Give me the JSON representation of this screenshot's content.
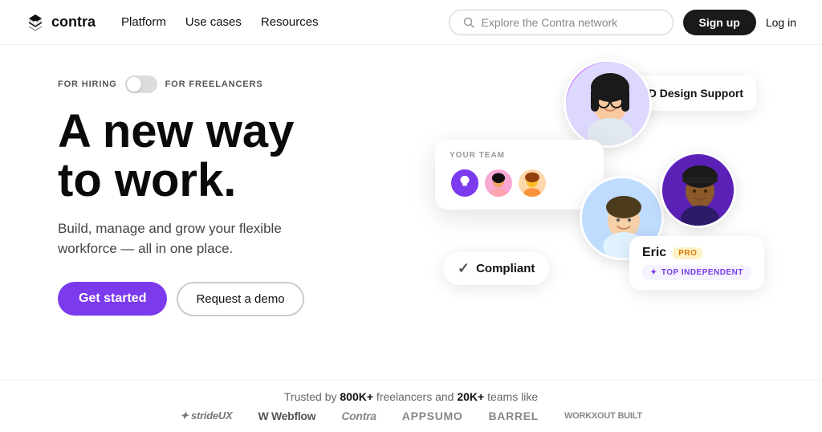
{
  "nav": {
    "logo_text": "contra",
    "links": [
      {
        "label": "Platform"
      },
      {
        "label": "Use cases"
      },
      {
        "label": "Resources"
      }
    ],
    "search_placeholder": "Explore the Contra network",
    "signup_label": "Sign up",
    "login_label": "Log in"
  },
  "toggle": {
    "for_hiring": "FOR HIRING",
    "for_freelancers": "FOR FREELANCERS"
  },
  "hero": {
    "title_line1": "A new way",
    "title_line2": "to work.",
    "subtitle": "Build, manage and grow your flexible workforce — all in one place.",
    "cta_primary": "Get started",
    "cta_secondary": "Request a demo"
  },
  "visual": {
    "team_card_label": "YOUR TEAM",
    "design_badge_label": "3D Design Support",
    "compliant_label": "Compliant",
    "eric_name": "Eric",
    "pro_badge": "PRO",
    "top_badge": "TOP INDEPENDENT"
  },
  "trusted": {
    "text_pre": "Trusted by ",
    "freelancers": "800K+",
    "text_mid": " freelancers and ",
    "teams": "20K+",
    "text_post": " teams like",
    "brands": [
      "strideUX",
      "Webflow",
      "Contra",
      "APPSUMO",
      "BARREL",
      "WORKXOUT BUILT"
    ]
  }
}
